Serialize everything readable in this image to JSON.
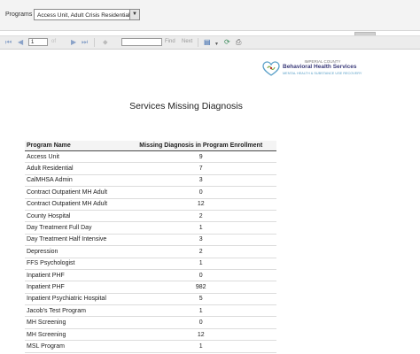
{
  "params": {
    "label": "Programs",
    "selected": "Access Unit, Adult Crisis Residential,"
  },
  "toolbar": {
    "page_number": "1",
    "of_text": "of",
    "find_label": "Find",
    "next_label": "Next"
  },
  "logo": {
    "county": "IMPERIAL COUNTY",
    "name": "Behavioral Health Services",
    "tagline": "MENTAL HEALTH & SUBSTANCE USE RECOVERY"
  },
  "report": {
    "title": "Services Missing Diagnosis",
    "columns": [
      "Program Name",
      "Missing Diagnosis in Program Enrollment"
    ],
    "rows": [
      {
        "program": "Access Unit",
        "count": "9"
      },
      {
        "program": "Adult Residential",
        "count": "7"
      },
      {
        "program": "CalMHSA Admin",
        "count": "3"
      },
      {
        "program": "Contract Outpatient MH Adult",
        "count": "0"
      },
      {
        "program": "Contract Outpatient MH Adult",
        "count": "12"
      },
      {
        "program": "County Hospital",
        "count": "2"
      },
      {
        "program": "Day Treatment Full Day",
        "count": "1"
      },
      {
        "program": "Day Treatment Half Intensive",
        "count": "3"
      },
      {
        "program": "Depression",
        "count": "2"
      },
      {
        "program": "FFS Psychologist",
        "count": "1"
      },
      {
        "program": "Inpatient PHF",
        "count": "0"
      },
      {
        "program": "Inpatient PHF",
        "count": "982"
      },
      {
        "program": "Inpatient Psychiatric Hospital",
        "count": "5"
      },
      {
        "program": "Jacob's Test Program",
        "count": "1"
      },
      {
        "program": "MH Screening",
        "count": "0"
      },
      {
        "program": "MH Screening",
        "count": "12"
      },
      {
        "program": "MSL Program",
        "count": "1"
      }
    ]
  }
}
